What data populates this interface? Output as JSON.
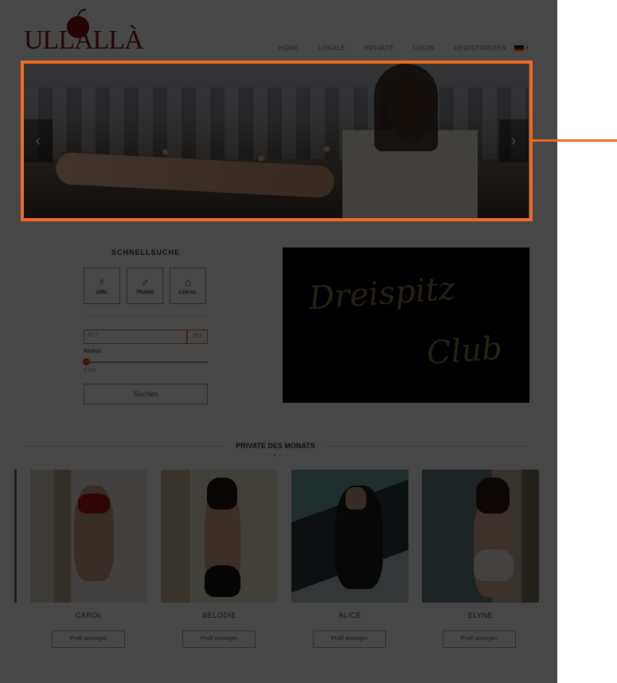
{
  "header": {
    "logo_text": "ULLALLÀ",
    "nav": [
      "HOME",
      "LOKALE",
      "PRIVATE",
      "LOGIN",
      "REGISTRIEREN"
    ],
    "language": "de"
  },
  "slider": {
    "prev_icon": "chevron-left-icon",
    "next_icon": "chevron-right-icon"
  },
  "quick_search": {
    "title": "SCHNELLSUCHE",
    "buttons": [
      {
        "label": "GIRL",
        "icon": "female-icon"
      },
      {
        "label": "TRANS",
        "icon": "male-icon"
      },
      {
        "label": "LOKAL",
        "icon": "house-icon"
      }
    ],
    "plz_placeholder": "PLZ",
    "go_label": "GO",
    "radius_label": "Radius:",
    "radius_value": "0 km",
    "search_label": "Suchen"
  },
  "banner": {
    "line1": "Dreispitz",
    "line2": "Club"
  },
  "section": {
    "title": "PRIVATE DES MONATS"
  },
  "cards": [
    {
      "name": "CAROL",
      "button": "Profil anzeigen"
    },
    {
      "name": "BELODIE",
      "button": "Profil anzeigen"
    },
    {
      "name": "ALICE",
      "button": "Profil anzeigen"
    },
    {
      "name": "ELYNE",
      "button": "Profil anzeigen"
    }
  ],
  "colors": {
    "accent": "#f26a24",
    "overlay": "rgba(0,0,0,0.72)",
    "banner_gold": "#8a7b40"
  }
}
